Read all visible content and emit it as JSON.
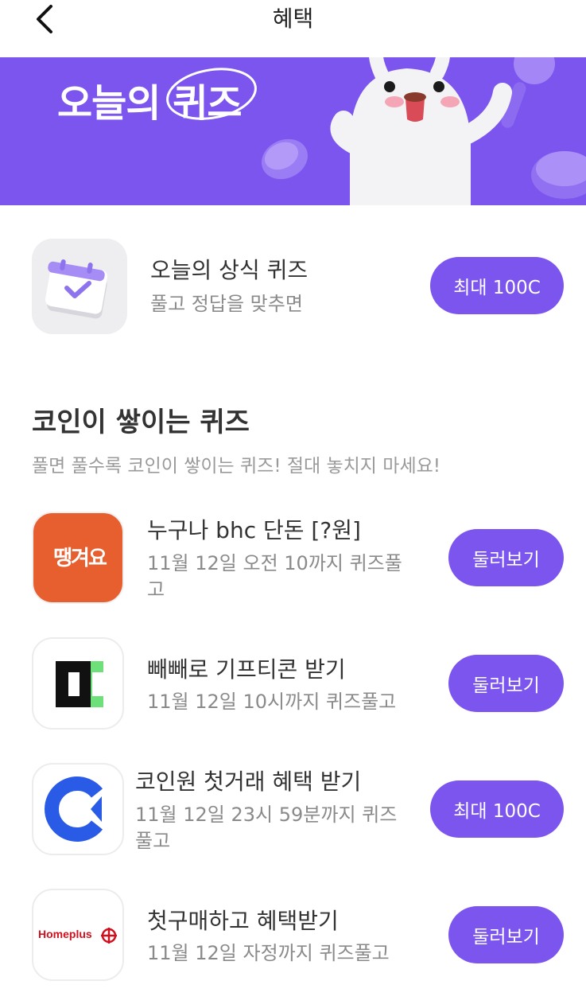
{
  "header": {
    "title": "혜택"
  },
  "banner": {
    "title_pre": "오늘의",
    "title_circled": "퀴즈"
  },
  "daily": {
    "title": "오늘의 상식 퀴즈",
    "subtitle": "풀고 정답을 맞추면",
    "button": "최대 100C"
  },
  "section": {
    "title": "코인이 쌓이는 퀴즈",
    "subtitle": "풀면 풀수록 코인이 쌓이는 퀴즈! 절대 놓치지 마세요!"
  },
  "quizzes": [
    {
      "brand": "땡겨요",
      "title": "누구나 bhc 단돈 [?원]",
      "subtitle": "11월 12일 오전 10까지 퀴즈풀고",
      "button": "둘러보기"
    },
    {
      "brand": "",
      "title": "빼빼로 기프티콘 받기",
      "subtitle": "11월 12일 10시까지 퀴즈풀고",
      "button": "둘러보기"
    },
    {
      "brand": "",
      "title": "코인원 첫거래 혜택 받기",
      "subtitle": "11월 12일 23시 59분까지 퀴즈풀고",
      "button": "최대 100C"
    },
    {
      "brand": "Homeplus",
      "title": "첫구매하고 혜택받기",
      "subtitle": "11월 12일 자정까지 퀴즈풀고",
      "button": "둘러보기"
    }
  ],
  "colors": {
    "accent": "#7b55ee",
    "ttaeng": "#e85f2f",
    "coinone": "#2a5be6",
    "homeplus": "#d0101e",
    "green": "#6ee07a"
  }
}
